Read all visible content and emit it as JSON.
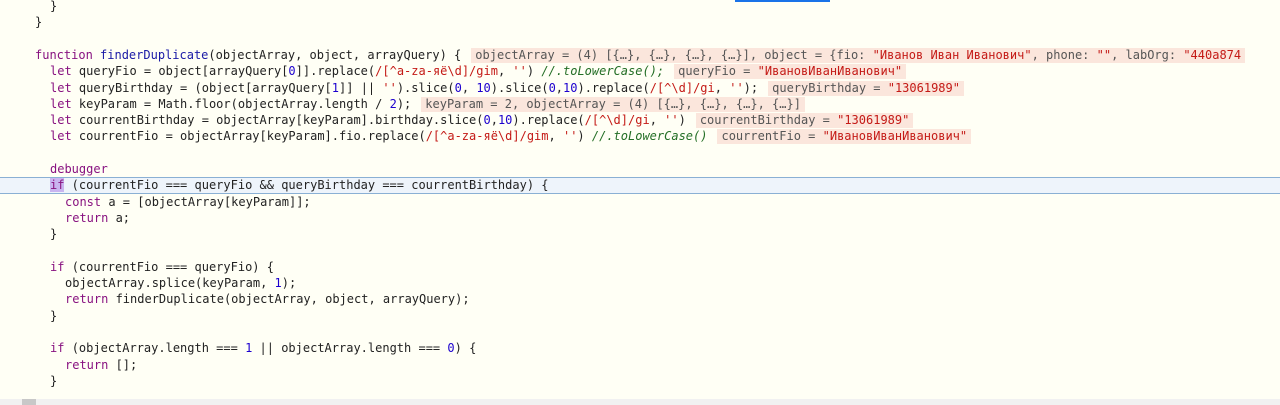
{
  "editor": {
    "lines": [
      {
        "indent": 1,
        "tokens": [
          {
            "t": "}",
            "c": "pl"
          }
        ]
      },
      {
        "indent": 0,
        "tokens": [
          {
            "t": "}",
            "c": "pl"
          }
        ]
      },
      {
        "indent": 0,
        "tokens": []
      },
      {
        "indent": 0,
        "tokens": [
          {
            "t": "function ",
            "c": "kw"
          },
          {
            "t": "finderDuplicate",
            "c": "fn"
          },
          {
            "t": "(objectArray, object, arrayQuery) {",
            "c": "pl"
          }
        ],
        "inline": [
          {
            "t": "objectArray = (4) [{…}, {…}, {…}, {…}], object = {fio: ",
            "c": "name"
          },
          {
            "t": "\"Иванов Иван Иванович\"",
            "c": "str"
          },
          {
            "t": ", phone: ",
            "c": "name"
          },
          {
            "t": "\"\"",
            "c": "str"
          },
          {
            "t": ", labOrg: ",
            "c": "name"
          },
          {
            "t": "\"440a874",
            "c": "str"
          }
        ]
      },
      {
        "indent": 1,
        "tokens": [
          {
            "t": "let ",
            "c": "kw"
          },
          {
            "t": "queryFio = object[arrayQuery[",
            "c": "pl"
          },
          {
            "t": "0",
            "c": "num"
          },
          {
            "t": "]].replace(",
            "c": "pl"
          },
          {
            "t": "/[^a-za-яё\\d]/gim",
            "c": "str"
          },
          {
            "t": ", ",
            "c": "pl"
          },
          {
            "t": "''",
            "c": "str"
          },
          {
            "t": ") ",
            "c": "pl"
          },
          {
            "t": "//.toLowerCase();",
            "c": "cm"
          }
        ],
        "inline": [
          {
            "t": "queryFio = ",
            "c": "name"
          },
          {
            "t": "\"ИвановИванИванович\"",
            "c": "str"
          }
        ]
      },
      {
        "indent": 1,
        "tokens": [
          {
            "t": "let ",
            "c": "kw"
          },
          {
            "t": "queryBirthday = (object[arrayQuery[",
            "c": "pl"
          },
          {
            "t": "1",
            "c": "num"
          },
          {
            "t": "]] || ",
            "c": "pl"
          },
          {
            "t": "''",
            "c": "str"
          },
          {
            "t": ").slice(",
            "c": "pl"
          },
          {
            "t": "0",
            "c": "num"
          },
          {
            "t": ", ",
            "c": "pl"
          },
          {
            "t": "10",
            "c": "num"
          },
          {
            "t": ").slice(",
            "c": "pl"
          },
          {
            "t": "0",
            "c": "num"
          },
          {
            "t": ",",
            "c": "pl"
          },
          {
            "t": "10",
            "c": "num"
          },
          {
            "t": ").replace(",
            "c": "pl"
          },
          {
            "t": "/[^\\d]/gi",
            "c": "str"
          },
          {
            "t": ", ",
            "c": "pl"
          },
          {
            "t": "''",
            "c": "str"
          },
          {
            "t": ");",
            "c": "pl"
          }
        ],
        "inline": [
          {
            "t": "queryBirthday = ",
            "c": "name"
          },
          {
            "t": "\"13061989\"",
            "c": "str"
          }
        ]
      },
      {
        "indent": 1,
        "tokens": [
          {
            "t": "let ",
            "c": "kw"
          },
          {
            "t": "keyParam = Math.floor(objectArray.length / ",
            "c": "pl"
          },
          {
            "t": "2",
            "c": "num"
          },
          {
            "t": ");",
            "c": "pl"
          }
        ],
        "inline": [
          {
            "t": "keyParam = 2, objectArray = (4) [{…}, {…}, {…}, {…}]",
            "c": "name"
          }
        ]
      },
      {
        "indent": 1,
        "tokens": [
          {
            "t": "let ",
            "c": "kw"
          },
          {
            "t": "courrentBirthday = objectArray[keyParam].birthday.slice(",
            "c": "pl"
          },
          {
            "t": "0",
            "c": "num"
          },
          {
            "t": ",",
            "c": "pl"
          },
          {
            "t": "10",
            "c": "num"
          },
          {
            "t": ").replace(",
            "c": "pl"
          },
          {
            "t": "/[^\\d]/gi",
            "c": "str"
          },
          {
            "t": ", ",
            "c": "pl"
          },
          {
            "t": "''",
            "c": "str"
          },
          {
            "t": ")",
            "c": "pl"
          }
        ],
        "inline": [
          {
            "t": "courrentBirthday = ",
            "c": "name"
          },
          {
            "t": "\"13061989\"",
            "c": "str"
          }
        ]
      },
      {
        "indent": 1,
        "tokens": [
          {
            "t": "let ",
            "c": "kw"
          },
          {
            "t": "courrentFio = objectArray[keyParam].fio.replace(",
            "c": "pl"
          },
          {
            "t": "/[^a-za-яё\\d]/gim",
            "c": "str"
          },
          {
            "t": ", ",
            "c": "pl"
          },
          {
            "t": "''",
            "c": "str"
          },
          {
            "t": ") ",
            "c": "pl"
          },
          {
            "t": "//.toLowerCase()",
            "c": "cm"
          }
        ],
        "inline": [
          {
            "t": "courrentFio = ",
            "c": "name"
          },
          {
            "t": "\"ИвановИванИванович\"",
            "c": "str"
          }
        ]
      },
      {
        "indent": 0,
        "tokens": []
      },
      {
        "indent": 1,
        "tokens": [
          {
            "t": "debugger",
            "c": "kw"
          }
        ]
      },
      {
        "indent": 1,
        "current": true,
        "tokens": [
          {
            "t": "if",
            "c": "kw",
            "hl": true
          },
          {
            "t": " (courrentFio === queryFio && queryBirthday === courrentBirthday) {",
            "c": "pl"
          }
        ]
      },
      {
        "indent": 2,
        "tokens": [
          {
            "t": "const ",
            "c": "kw"
          },
          {
            "t": "a = [objectArray[keyParam]];",
            "c": "pl"
          }
        ]
      },
      {
        "indent": 2,
        "tokens": [
          {
            "t": "return ",
            "c": "kw"
          },
          {
            "t": "a;",
            "c": "pl"
          }
        ]
      },
      {
        "indent": 1,
        "tokens": [
          {
            "t": "}",
            "c": "pl"
          }
        ]
      },
      {
        "indent": 0,
        "tokens": []
      },
      {
        "indent": 1,
        "tokens": [
          {
            "t": "if ",
            "c": "kw"
          },
          {
            "t": "(courrentFio === queryFio) {",
            "c": "pl"
          }
        ]
      },
      {
        "indent": 2,
        "tokens": [
          {
            "t": "objectArray.splice(keyParam, ",
            "c": "pl"
          },
          {
            "t": "1",
            "c": "num"
          },
          {
            "t": ");",
            "c": "pl"
          }
        ]
      },
      {
        "indent": 2,
        "tokens": [
          {
            "t": "return ",
            "c": "kw"
          },
          {
            "t": "finderDuplicate(objectArray, object, arrayQuery);",
            "c": "pl"
          }
        ]
      },
      {
        "indent": 1,
        "tokens": [
          {
            "t": "}",
            "c": "pl"
          }
        ]
      },
      {
        "indent": 0,
        "tokens": []
      },
      {
        "indent": 1,
        "tokens": [
          {
            "t": "if ",
            "c": "kw"
          },
          {
            "t": "(objectArray.length === ",
            "c": "pl"
          },
          {
            "t": "1",
            "c": "num"
          },
          {
            "t": " || objectArray.length === ",
            "c": "pl"
          },
          {
            "t": "0",
            "c": "num"
          },
          {
            "t": ") {",
            "c": "pl"
          }
        ]
      },
      {
        "indent": 2,
        "tokens": [
          {
            "t": "return ",
            "c": "kw"
          },
          {
            "t": "[];",
            "c": "pl"
          }
        ]
      },
      {
        "indent": 1,
        "tokens": [
          {
            "t": "}",
            "c": "pl"
          }
        ]
      }
    ]
  }
}
